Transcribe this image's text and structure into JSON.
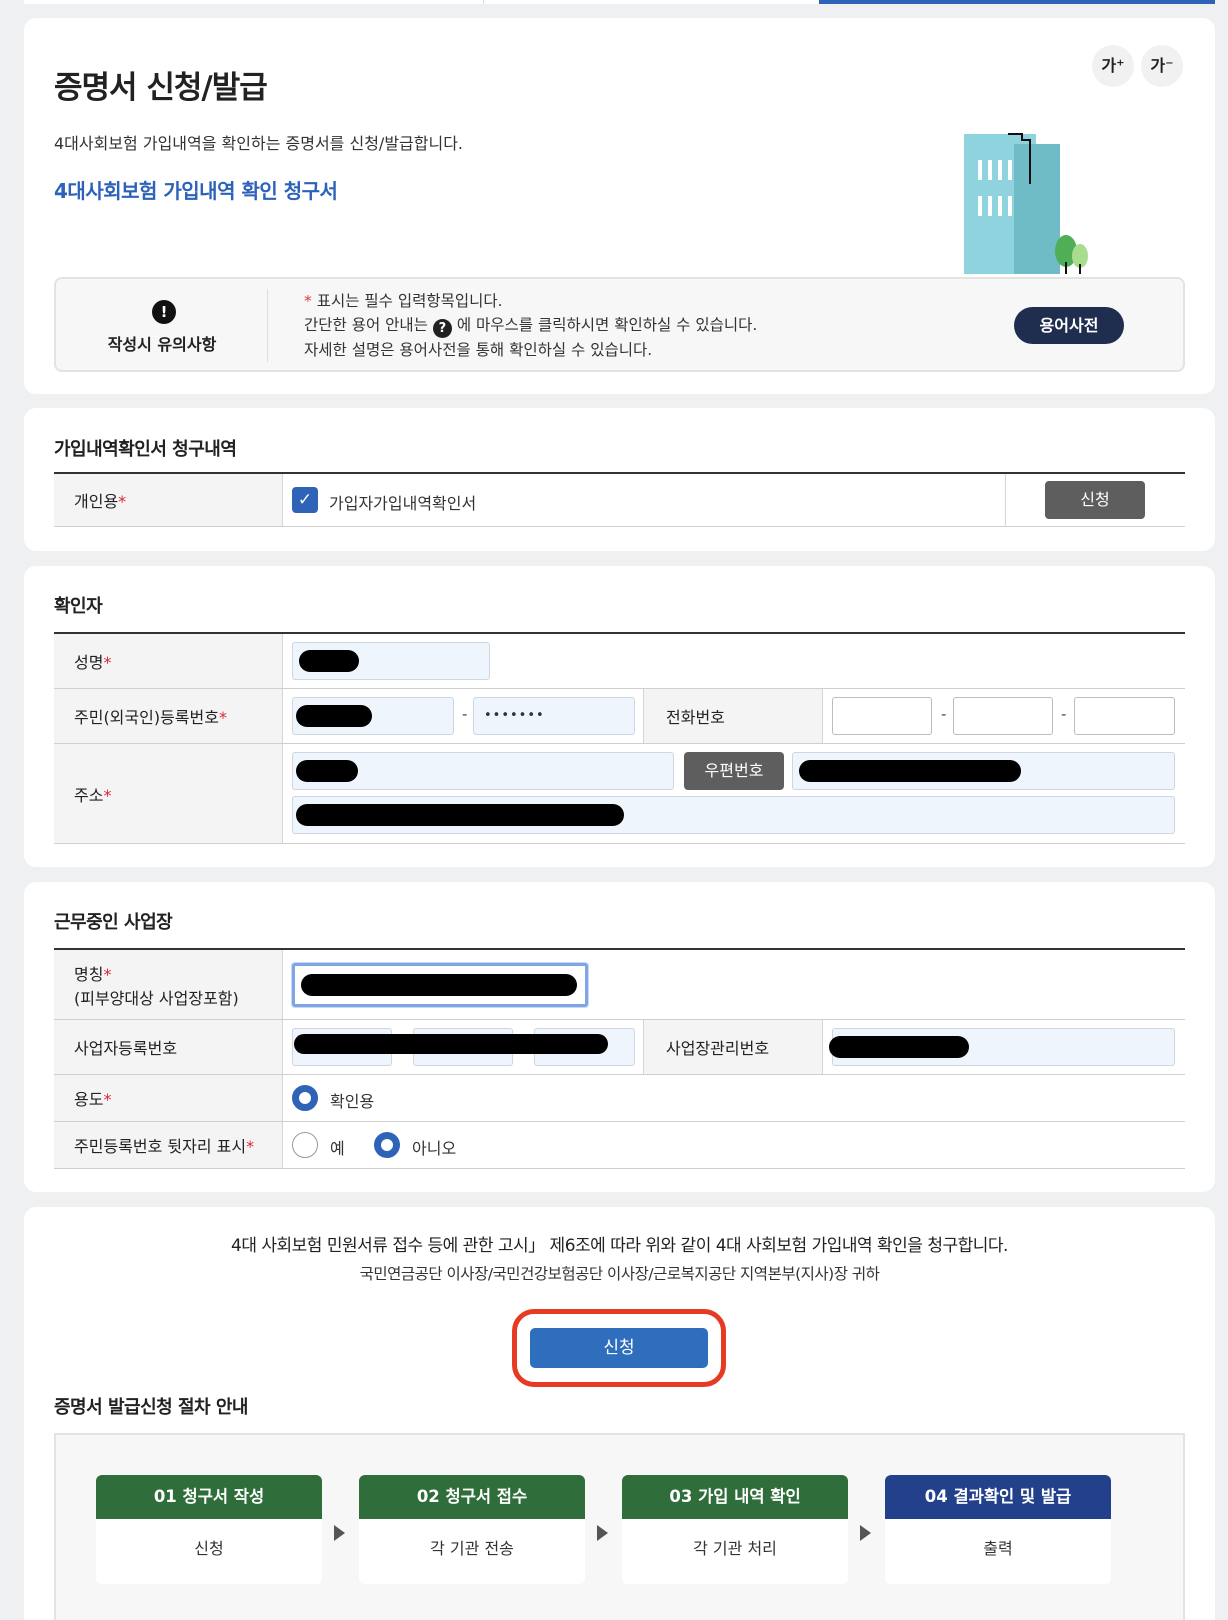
{
  "header": {
    "title": "증명서 신청/발급",
    "description": "4대사회보험 가입내역을 확인하는 증명서를 신청/발급합니다.",
    "form_link": "4대사회보험 가입내역 확인 청구서",
    "font_increase_label": "가⁺",
    "font_decrease_label": "가⁻"
  },
  "notice": {
    "icon": "!",
    "label": "작성시 유의사항",
    "line1_star": "*",
    "line1_text": "표시는 필수 입력항목입니다.",
    "line2_before": "간단한 용어 안내는",
    "line2_icon": "?",
    "line2_after": "에 마우스를 클릭하시면 확인하실 수 있습니다.",
    "line3": "자세한 설명은 용어사전을 통해 확인하실 수 있습니다.",
    "dict_button": "용어사전"
  },
  "request": {
    "title": "가입내역확인서 청구내역",
    "row_label": "개인용",
    "required_mark": "*",
    "checkbox_label": "가입자가입내역확인서",
    "checkbox_checked": true,
    "apply_button": "신청"
  },
  "confirmer": {
    "title": "확인자",
    "name_label": "성명",
    "rrn_label": "주민(외국인)등록번호",
    "rrn_dash": "-",
    "rrn_masked": "•••••••",
    "phone_label": "전화번호",
    "phone_dash": "-",
    "address_label": "주소",
    "zipcode_button": "우편번호",
    "required_mark": "*"
  },
  "workplace": {
    "title": "근무중인 사업장",
    "name_label": "명칭",
    "name_sublabel": "(피부양대상 사업장포함)",
    "biz_no_label": "사업자등록번호",
    "mgmt_no_label": "사업장관리번호",
    "purpose_label": "용도",
    "purpose_option": "확인용",
    "rrn_show_label": "주민등록번호 뒷자리 표시",
    "rrn_show_yes": "예",
    "rrn_show_no": "아니오",
    "rrn_show_selected": "아니오",
    "required_mark": "*"
  },
  "declaration": {
    "line1": "4대 사회보험 민원서류 접수 등에 관한 고시」 제6조에 따라 위와 같이 4대 사회보험 가입내역 확인을 청구합니다.",
    "line2": "국민연금공단 이사장/국민건강보험공단 이사장/근로복지공단 지역본부(지사)장 귀하",
    "submit_button": "신청"
  },
  "process": {
    "title": "증명서 발급신청 절차 안내",
    "steps": [
      {
        "head": "01 청구서 작성",
        "body": "신청"
      },
      {
        "head": "02 청구서 접수",
        "body": "각 기관 전송"
      },
      {
        "head": "03 가입 내역 확인",
        "body": "각 기관 처리"
      },
      {
        "head": "04 결과확인 및 발급",
        "body": "출력"
      }
    ]
  },
  "colors": {
    "accent": "#2f63b8",
    "highlight": "#e63a22",
    "step_green": "#2f6e3a",
    "step_blue": "#22418a"
  }
}
